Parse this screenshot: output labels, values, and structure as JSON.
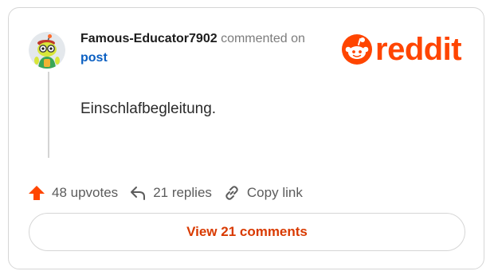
{
  "comment": {
    "author": "Famous-Educator7902",
    "commented_text": "commented on",
    "post_link": "post",
    "body": "Einschlafbegleitung."
  },
  "brand": {
    "name": "reddit",
    "color": "#ff4500"
  },
  "actions": {
    "upvotes": "48 upvotes",
    "replies": "21 replies",
    "copy_link": "Copy link"
  },
  "footer": {
    "view_comments": "View 21 comments"
  },
  "icons": {
    "upvote": "upvote-arrow-icon",
    "reply": "reply-arrow-icon",
    "link": "chain-link-icon"
  }
}
